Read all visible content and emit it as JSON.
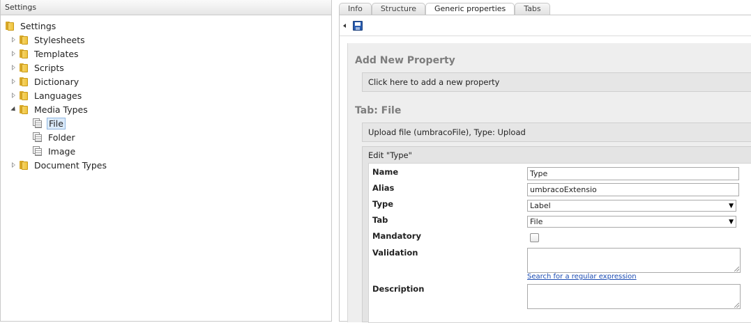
{
  "left": {
    "header": "Settings",
    "tree": [
      {
        "label": "Settings",
        "icon": "folder-icon",
        "expander": "none",
        "selected": false
      },
      {
        "label": "Stylesheets",
        "icon": "folder-icon",
        "expander": "collapsed",
        "selected": false
      },
      {
        "label": "Templates",
        "icon": "folder-icon",
        "expander": "collapsed",
        "selected": false
      },
      {
        "label": "Scripts",
        "icon": "folder-icon",
        "expander": "collapsed",
        "selected": false
      },
      {
        "label": "Dictionary",
        "icon": "folder-icon",
        "expander": "collapsed",
        "selected": false
      },
      {
        "label": "Languages",
        "icon": "folder-icon",
        "expander": "collapsed",
        "selected": false
      },
      {
        "label": "Media Types",
        "icon": "folder-icon",
        "expander": "expanded",
        "selected": false
      },
      {
        "label": "File",
        "icon": "media-type-icon",
        "expander": "none",
        "selected": true
      },
      {
        "label": "Folder",
        "icon": "media-type-icon",
        "expander": "none",
        "selected": false
      },
      {
        "label": "Image",
        "icon": "media-type-icon",
        "expander": "none",
        "selected": false
      },
      {
        "label": "Document Types",
        "icon": "folder-icon",
        "expander": "collapsed",
        "selected": false
      }
    ]
  },
  "right": {
    "tabs": [
      {
        "label": "Info",
        "active": false
      },
      {
        "label": "Structure",
        "active": false
      },
      {
        "label": "Generic properties",
        "active": true
      },
      {
        "label": "Tabs",
        "active": false
      }
    ],
    "add_section_title": "Add New Property",
    "add_property_label": "Click here to add a new property",
    "tab_section_title": "Tab: File",
    "property_header": "Upload file (umbracoFile), Type: Upload",
    "edit_title": "Edit \"Type\"",
    "form": {
      "name_label": "Name",
      "name_value": "Type",
      "alias_label": "Alias",
      "alias_value": "umbracoExtensio",
      "type_label": "Type",
      "type_value": "Label",
      "tab_label": "Tab",
      "tab_value": "File",
      "mandatory_label": "Mandatory",
      "mandatory_checked": false,
      "validation_label": "Validation",
      "validation_value": "",
      "regex_link": "Search for a regular expression",
      "description_label": "Description",
      "description_value": ""
    }
  },
  "colors": {
    "selected_bg": "#dcebfb",
    "link": "#1a4bb3",
    "folder": "#eec33d",
    "section_title": "#7d7d7d"
  }
}
